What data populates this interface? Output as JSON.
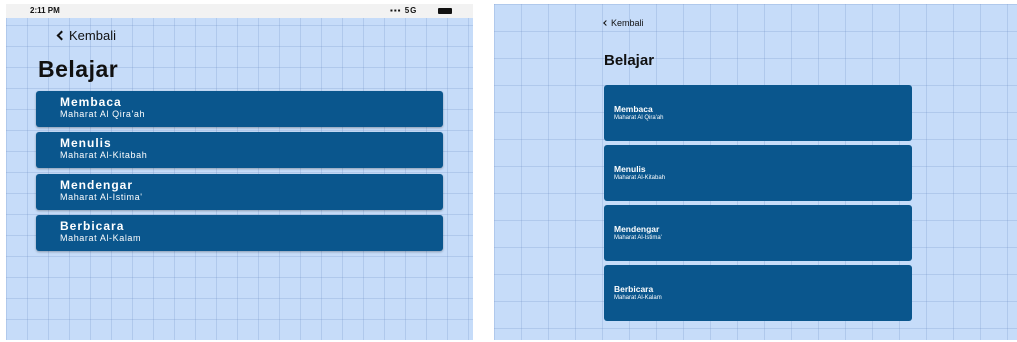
{
  "left_screen": {
    "status": {
      "time": "2:11 PM",
      "network": "5G"
    },
    "back_label": "Kembali",
    "title": "Belajar",
    "items": [
      {
        "title": "Membaca",
        "subtitle": "Maharat Al Qira'ah"
      },
      {
        "title": "Menulis",
        "subtitle": "Maharat Al-Kitabah"
      },
      {
        "title": "Mendengar",
        "subtitle": "Maharat Al-Istima'"
      },
      {
        "title": "Berbicara",
        "subtitle": "Maharat Al-Kalam"
      }
    ]
  },
  "right_screen": {
    "back_label": "Kembali",
    "title": "Belajar",
    "items": [
      {
        "title": "Membaca",
        "subtitle": "Maharat Al Qira'ah"
      },
      {
        "title": "Menulis",
        "subtitle": "Maharat Al-Kitabah"
      },
      {
        "title": "Mendengar",
        "subtitle": "Maharat Al-Istima'"
      },
      {
        "title": "Berbicara",
        "subtitle": "Maharat Al-Kalam"
      }
    ]
  },
  "colors": {
    "background": "#c6dcf9",
    "card": "#0a568d",
    "card_text": "#ffffff"
  }
}
